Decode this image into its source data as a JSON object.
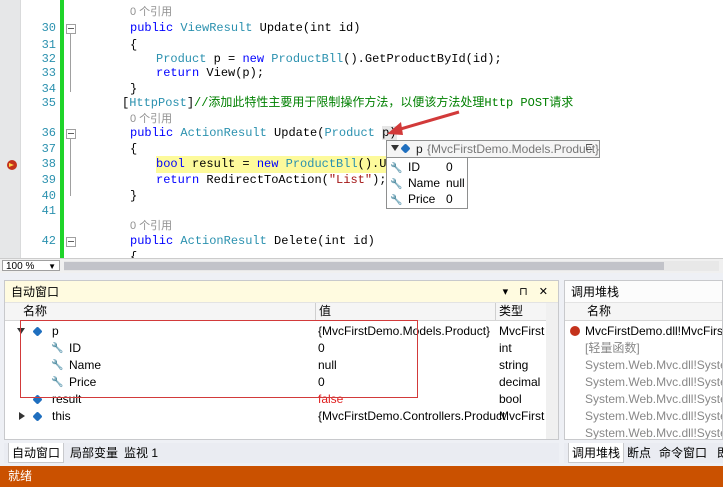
{
  "editor": {
    "ref_label": "0 个引用",
    "lines": [
      {
        "num": "",
        "ref": "0 个引用"
      },
      {
        "num": "30",
        "pre": "public ",
        "kw1": "",
        "type": "ViewResult",
        "rest": " Update(int id)"
      },
      {
        "num": "31",
        "text": "{"
      },
      {
        "num": "32",
        "text": "Product p = new ProductBll().GetProductById(id);"
      },
      {
        "num": "33",
        "text": "return View(p);"
      },
      {
        "num": "34",
        "text": "}"
      },
      {
        "num": "35",
        "attr": "[HttpPost]",
        "comment": "//添加此特性主要用于限制操作方法，以便该方法处理Http POST请求"
      },
      {
        "num": "",
        "ref": "0 个引用"
      },
      {
        "num": "36",
        "text": "public ActionResult Update(Product p)"
      },
      {
        "num": "37",
        "text": "{"
      },
      {
        "num": "38",
        "text": "bool result = new ProductBll().Upda"
      },
      {
        "num": "39",
        "text": "return RedirectToAction(\"List\");"
      },
      {
        "num": "40",
        "text": "}"
      },
      {
        "num": "41",
        "text": ""
      },
      {
        "num": "",
        "ref": "0 个引用"
      },
      {
        "num": "42",
        "text": "public ActionResult Delete(int id)"
      },
      {
        "num": "43",
        "text": "{"
      }
    ],
    "l30_kw": "public",
    "l30_type": "ViewResult",
    "l30_rest": "Update(int id)",
    "l32_type": "Product",
    "l32_mid": "p =",
    "l32_kw": "new",
    "l32_type2": "ProductBll",
    "l32_rest": "().GetProductById(id);",
    "l33_kw": "return",
    "l33_rest": "View(p);",
    "l35_attr": "HttpPost",
    "l35_comment": "//添加此特性主要用于限制操作方法，以便该方法处理Http POST请求",
    "l36_kw": "public",
    "l36_type": "ActionResult",
    "l36_mid": "Update(",
    "l36_type2": "Product",
    "l36_rest": "p)",
    "l38_kw": "bool",
    "l38_mid": "result =",
    "l38_kw2": "new",
    "l38_type": "ProductBll",
    "l38_rest": "().Upda",
    "l39_kw": "return",
    "l39_mid": "RedirectToAction(",
    "l39_str": "\"List\"",
    "l39_rest": ");",
    "l42_kw": "public",
    "l42_type": "ActionResult",
    "l42_rest": "Delete(int id)"
  },
  "zoom": {
    "value": "100 %"
  },
  "datatip": {
    "var": "p",
    "type": "{MvcFirstDemo.Models.Product}",
    "rows": [
      {
        "name": "ID",
        "value": "0"
      },
      {
        "name": "Name",
        "value": "null"
      },
      {
        "name": "Price",
        "value": "0"
      }
    ]
  },
  "autos": {
    "title": "自动窗口",
    "title_controls": "▾ ⊓ ✕",
    "columns": {
      "name": "名称",
      "value": "值",
      "type": "类型"
    },
    "rows": [
      {
        "name": "p",
        "value": "{MvcFirstDemo.Models.Product}",
        "type": "MvcFirst"
      },
      {
        "name": "ID",
        "value": "0",
        "type": "int"
      },
      {
        "name": "Name",
        "value": "null",
        "type": "string"
      },
      {
        "name": "Price",
        "value": "0",
        "type": "decimal"
      },
      {
        "name": "result",
        "value": "false",
        "type": "bool"
      },
      {
        "name": "this",
        "value": "{MvcFirstDemo.Controllers.Product",
        "type": "MvcFirst"
      }
    ],
    "tabs": [
      "自动窗口",
      "局部变量",
      "监视 1"
    ]
  },
  "callstack": {
    "title": "调用堆栈",
    "column": "名称",
    "rows": [
      "MvcFirstDemo.dll!MvcFirst",
      "[轻量函数]",
      "System.Web.Mvc.dll!Syster",
      "System.Web.Mvc.dll!Syster",
      "System.Web.Mvc.dll!Syster",
      "System.Web.Mvc.dll!Syster",
      "System.Web.Mvc.dll!Syster"
    ],
    "tabs": [
      "调用堆栈",
      "断点",
      "命令窗口",
      "即"
    ]
  },
  "status": {
    "text": "就绪"
  },
  "colors": {
    "status_bar": "#ca5100",
    "highlight": "#fdfa9b",
    "annotation": "#d23a3a",
    "change_bar": "#1fd42a"
  }
}
